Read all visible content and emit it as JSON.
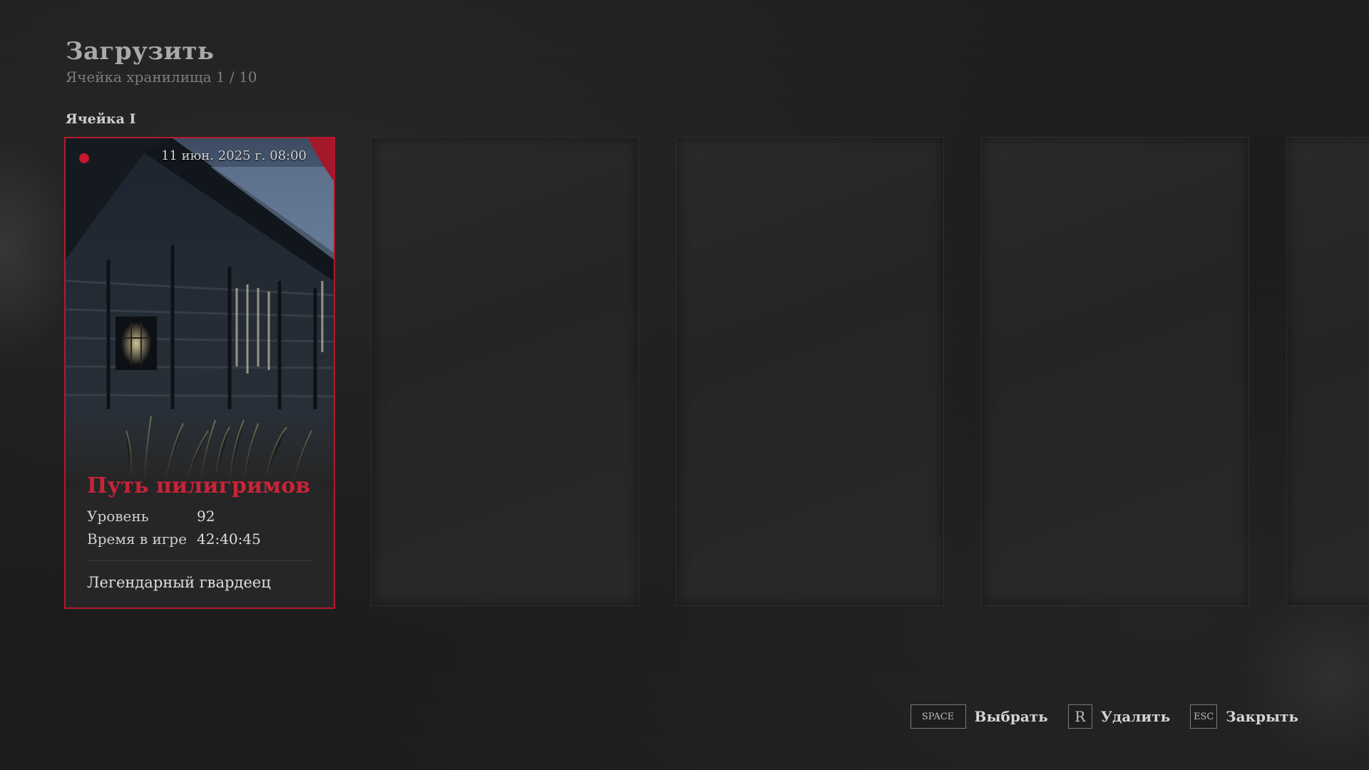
{
  "header": {
    "title": "Загрузить",
    "subtitle": "Ячейка хранилища 1 / 10"
  },
  "slot": {
    "heading": "Ячейка I"
  },
  "save_card": {
    "timestamp": "11 июн. 2025 г. 08:00",
    "name": "Путь пилигримов",
    "stats": [
      {
        "label": "Уровень",
        "value": "92"
      },
      {
        "label": "Время в игре",
        "value": "42:40:45"
      }
    ],
    "rank": "Легендарный гвардеец",
    "accent_color": "#c8233a",
    "border_color": "#b3192d"
  },
  "empty_slot_count": 4,
  "footer": {
    "hints": [
      {
        "key": "SPACE",
        "label": "Выбрать"
      },
      {
        "key": "R",
        "label": "Удалить"
      },
      {
        "key": "ESC",
        "label": "Закрыть"
      }
    ]
  },
  "colors": {
    "background": "#1c1c1c",
    "card_empty": "#252525",
    "title_text": "#a9a9a9"
  }
}
